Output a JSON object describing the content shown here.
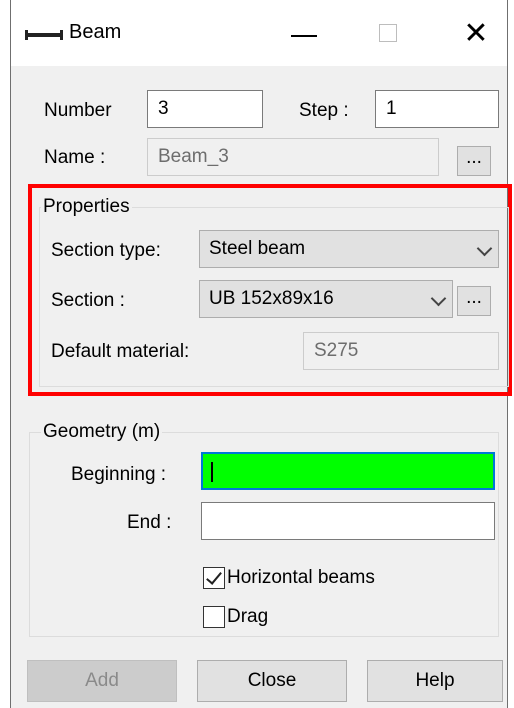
{
  "window": {
    "title": "Beam",
    "icon": "beam-icon"
  },
  "fields": {
    "number_label": "Number",
    "number_value": "3",
    "step_label": "Step :",
    "step_value": "1",
    "name_label": "Name :",
    "name_value": "Beam_3",
    "name_browse": "..."
  },
  "properties": {
    "title": "Properties",
    "section_type_label": "Section type:",
    "section_type_value": "Steel beam",
    "section_label": "Section :",
    "section_value": "UB 152x89x16",
    "section_browse": "...",
    "material_label": "Default material:",
    "material_value": "S275"
  },
  "geometry": {
    "title": "Geometry (m)",
    "beginning_label": "Beginning :",
    "beginning_value": "",
    "end_label": "End :",
    "end_value": "",
    "horizontal_label": "Horizontal beams",
    "horizontal_checked": true,
    "drag_label": "Drag",
    "drag_checked": false
  },
  "buttons": {
    "add": "Add",
    "close": "Close",
    "help": "Help"
  },
  "colors": {
    "highlight": "#ff0000",
    "active_field": "#00ff00"
  }
}
